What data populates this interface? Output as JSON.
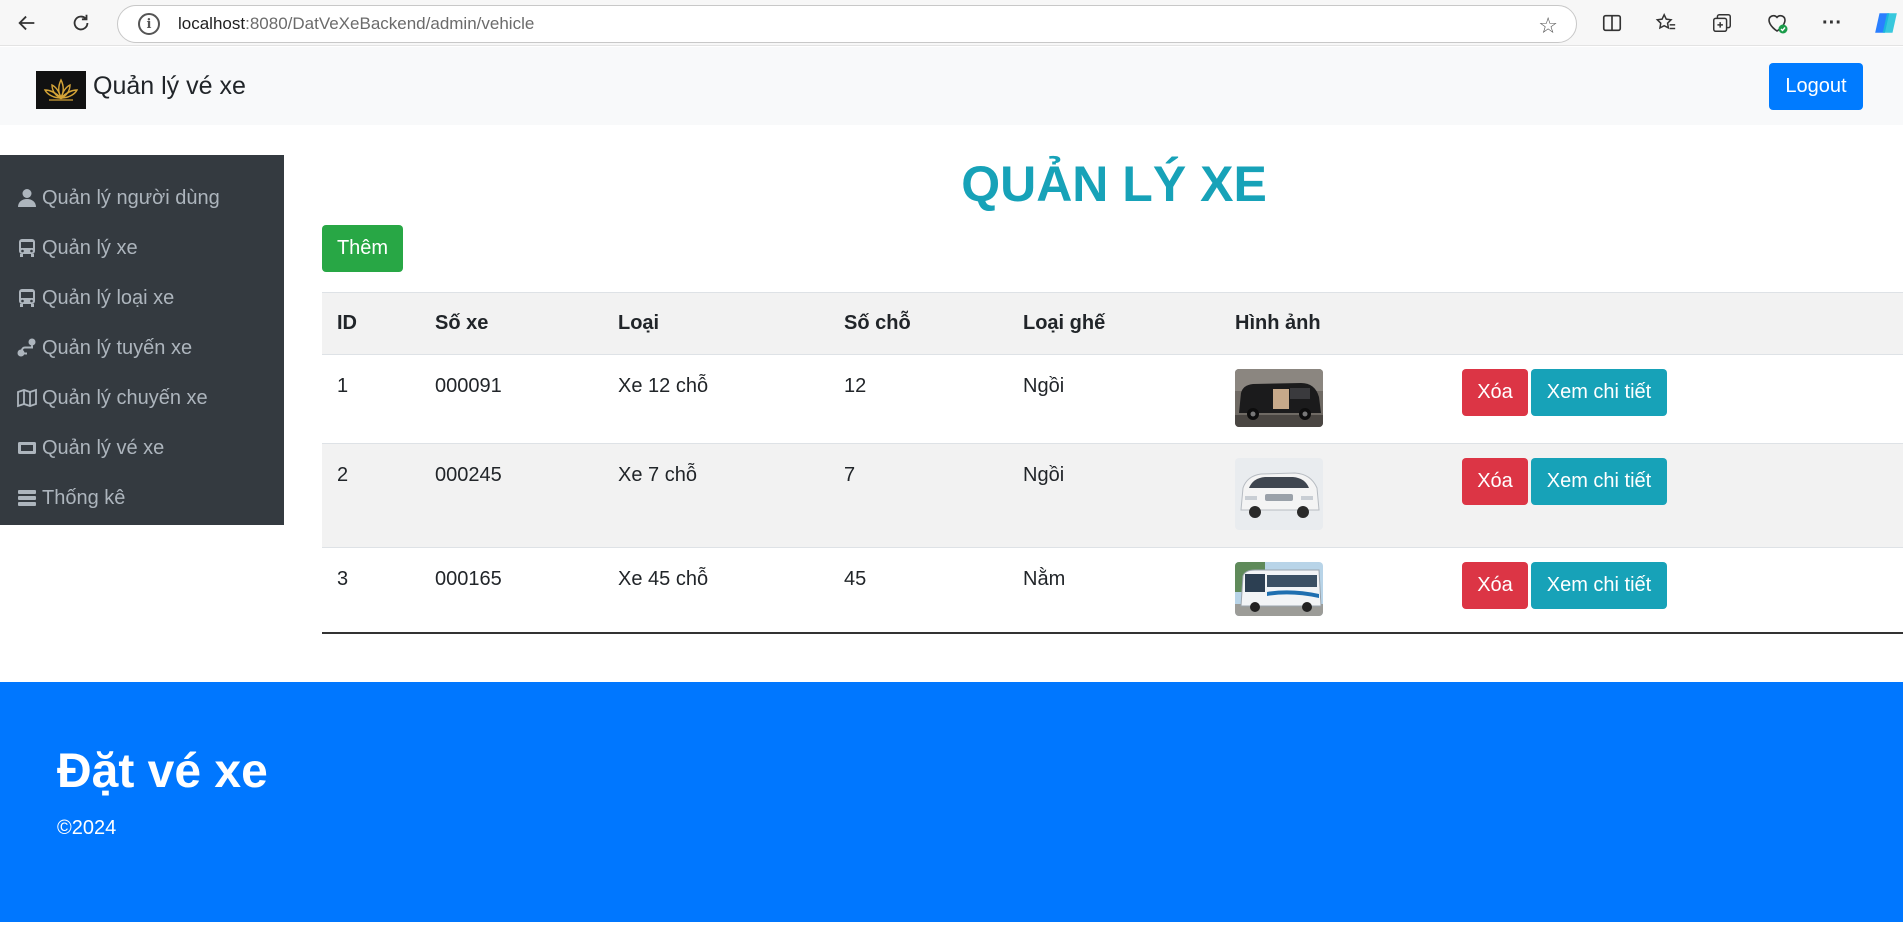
{
  "browser": {
    "url_host": "localhost",
    "url_rest": ":8080/DatVeXeBackend/admin/vehicle"
  },
  "navbar": {
    "brand": "Quản lý vé xe",
    "logout_label": "Logout"
  },
  "sidebar": {
    "items": [
      {
        "label": "Quản lý người dùng",
        "icon": "user-icon"
      },
      {
        "label": "Quản lý xe",
        "icon": "bus-icon"
      },
      {
        "label": "Quản lý loại xe",
        "icon": "bus-icon"
      },
      {
        "label": "Quản lý tuyến xe",
        "icon": "route-icon"
      },
      {
        "label": "Quản lý chuyến xe",
        "icon": "map-icon"
      },
      {
        "label": "Quản lý vé xe",
        "icon": "ticket-icon"
      },
      {
        "label": "Thống kê",
        "icon": "bars-icon"
      }
    ]
  },
  "main": {
    "title": "QUẢN LÝ XE",
    "add_label": "Thêm",
    "columns": [
      "ID",
      "Số xe",
      "Loại",
      "Số chỗ",
      "Loại ghế",
      "Hình ảnh",
      ""
    ],
    "rows": [
      {
        "id": "1",
        "plate": "000091",
        "type": "Xe 12 chỗ",
        "seats": "12",
        "seat_type": "Ngồi",
        "image": "black-van-photo"
      },
      {
        "id": "2",
        "plate": "000245",
        "type": "Xe 7 chỗ",
        "seats": "7",
        "seat_type": "Ngồi",
        "image": "white-minivan-photo"
      },
      {
        "id": "3",
        "plate": "000165",
        "type": "Xe 45 chỗ",
        "seats": "45",
        "seat_type": "Nằm",
        "image": "white-coach-bus-photo"
      }
    ],
    "delete_label": "Xóa",
    "view_label": "Xem chi tiết"
  },
  "footer": {
    "title": "Đặt vé xe",
    "copyright": "©2024"
  },
  "colors": {
    "primary": "#007bff",
    "info": "#17a2b8",
    "success": "#28a745",
    "danger": "#dc3545",
    "sidebar_bg": "#343a40",
    "footer_bg": "#0077ff"
  }
}
